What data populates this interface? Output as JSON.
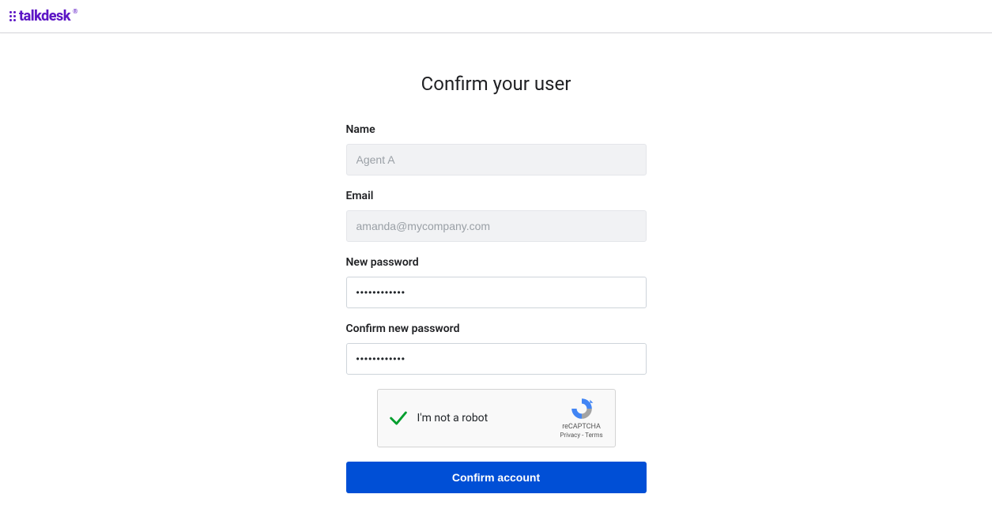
{
  "header": {
    "logo_text": "talkdesk",
    "logo_reg": "®"
  },
  "page": {
    "title": "Confirm your user"
  },
  "form": {
    "name": {
      "label": "Name",
      "value": "Agent A"
    },
    "email": {
      "label": "Email",
      "value": "amanda@mycompany.com"
    },
    "new_password": {
      "label": "New password",
      "value": "••••••••••••"
    },
    "confirm_password": {
      "label": "Confirm new password",
      "value": "••••••••••••"
    },
    "recaptcha": {
      "label": "I'm not a robot",
      "brand": "reCAPTCHA",
      "terms": "Privacy - Terms",
      "checked": true
    },
    "submit_label": "Confirm account"
  },
  "colors": {
    "brand": "#5c16c5",
    "primary_button": "#004fd6",
    "check_green": "#009e2d"
  }
}
